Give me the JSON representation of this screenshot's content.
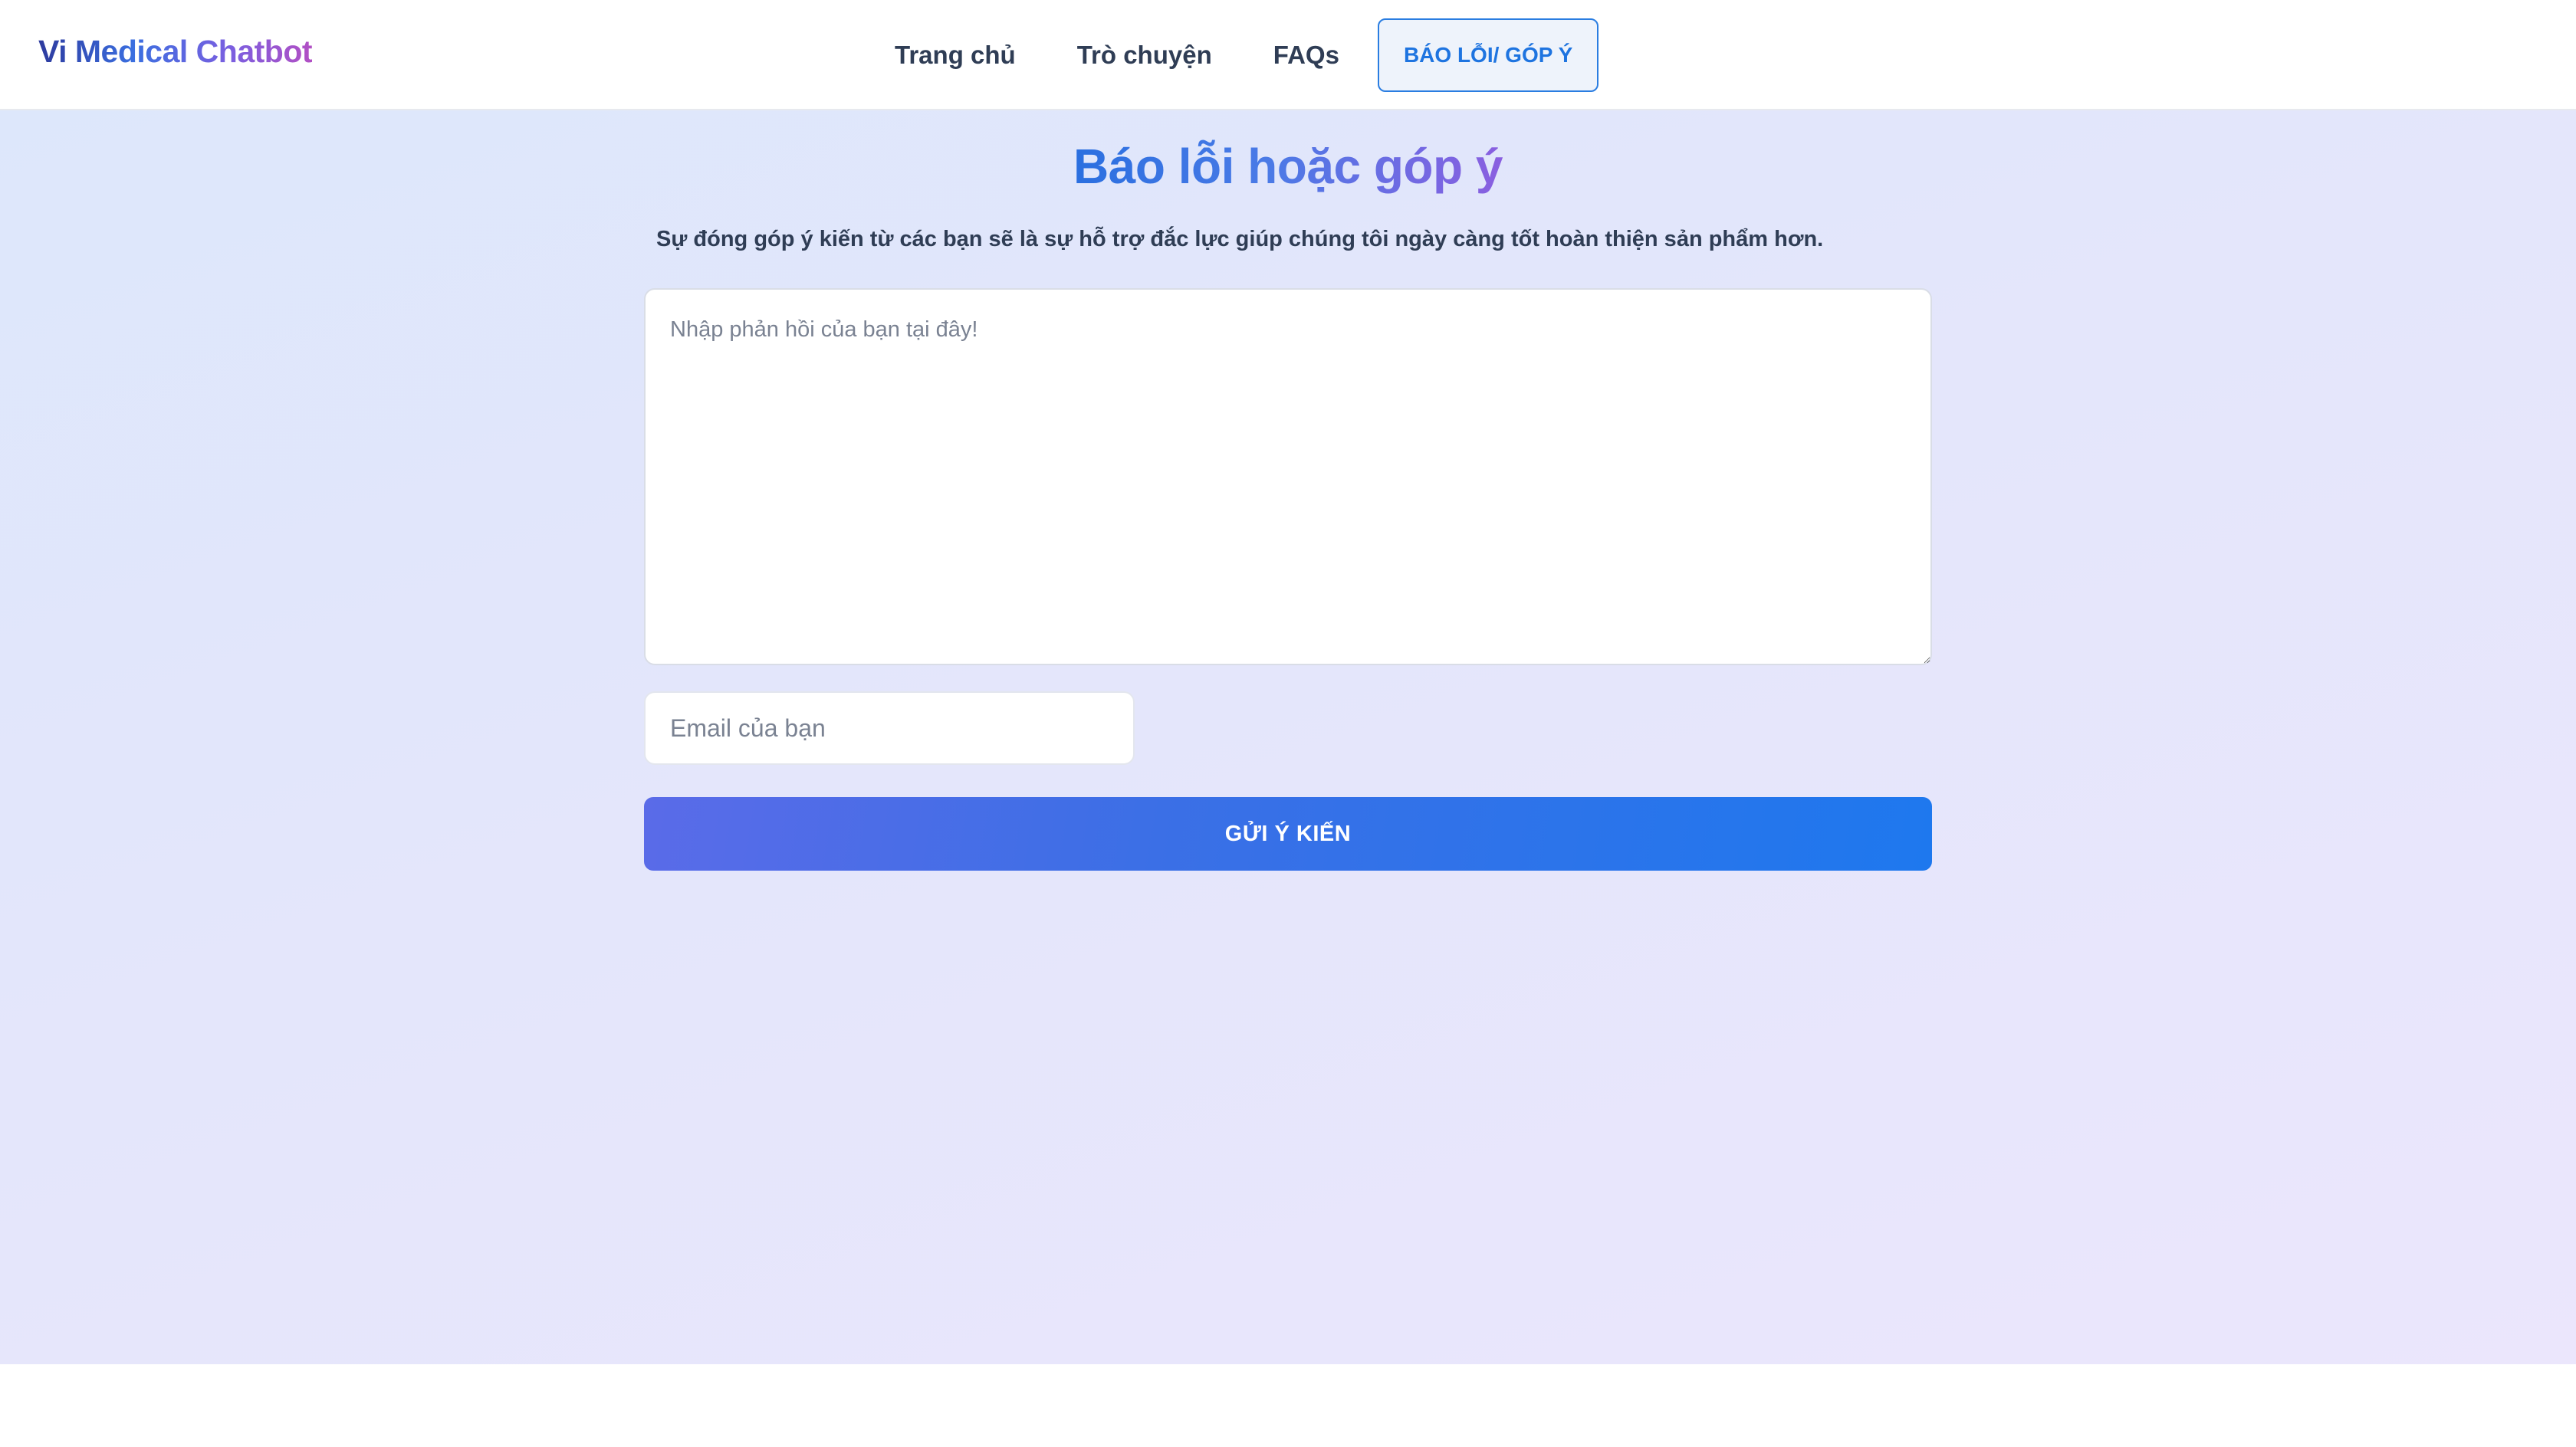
{
  "brand": {
    "name": "Vi Medical Chatbot"
  },
  "nav": {
    "items": [
      {
        "label": "Trang chủ"
      },
      {
        "label": "Trò chuyện"
      },
      {
        "label": "FAQs"
      }
    ],
    "active_label": "BÁO LỖI/ GÓP Ý"
  },
  "page": {
    "title": "Báo lỗi hoặc góp ý",
    "subtitle": "Sự đóng góp ý kiến từ các bạn sẽ là sự hỗ trợ đắc lực giúp chúng tôi ngày càng tốt hoàn thiện sản phẩm hơn."
  },
  "form": {
    "feedback_placeholder": "Nhập phản hồi của bạn tại đây!",
    "feedback_value": "",
    "email_placeholder": "Email của bạn",
    "email_value": "",
    "submit_label": "GỬI Ý KIẾN"
  },
  "colors": {
    "accent": "#1e74e0",
    "text_dark": "#2f3d55",
    "bg_gradient_start": "#dde7fb",
    "bg_gradient_end": "#ebe6fc"
  }
}
